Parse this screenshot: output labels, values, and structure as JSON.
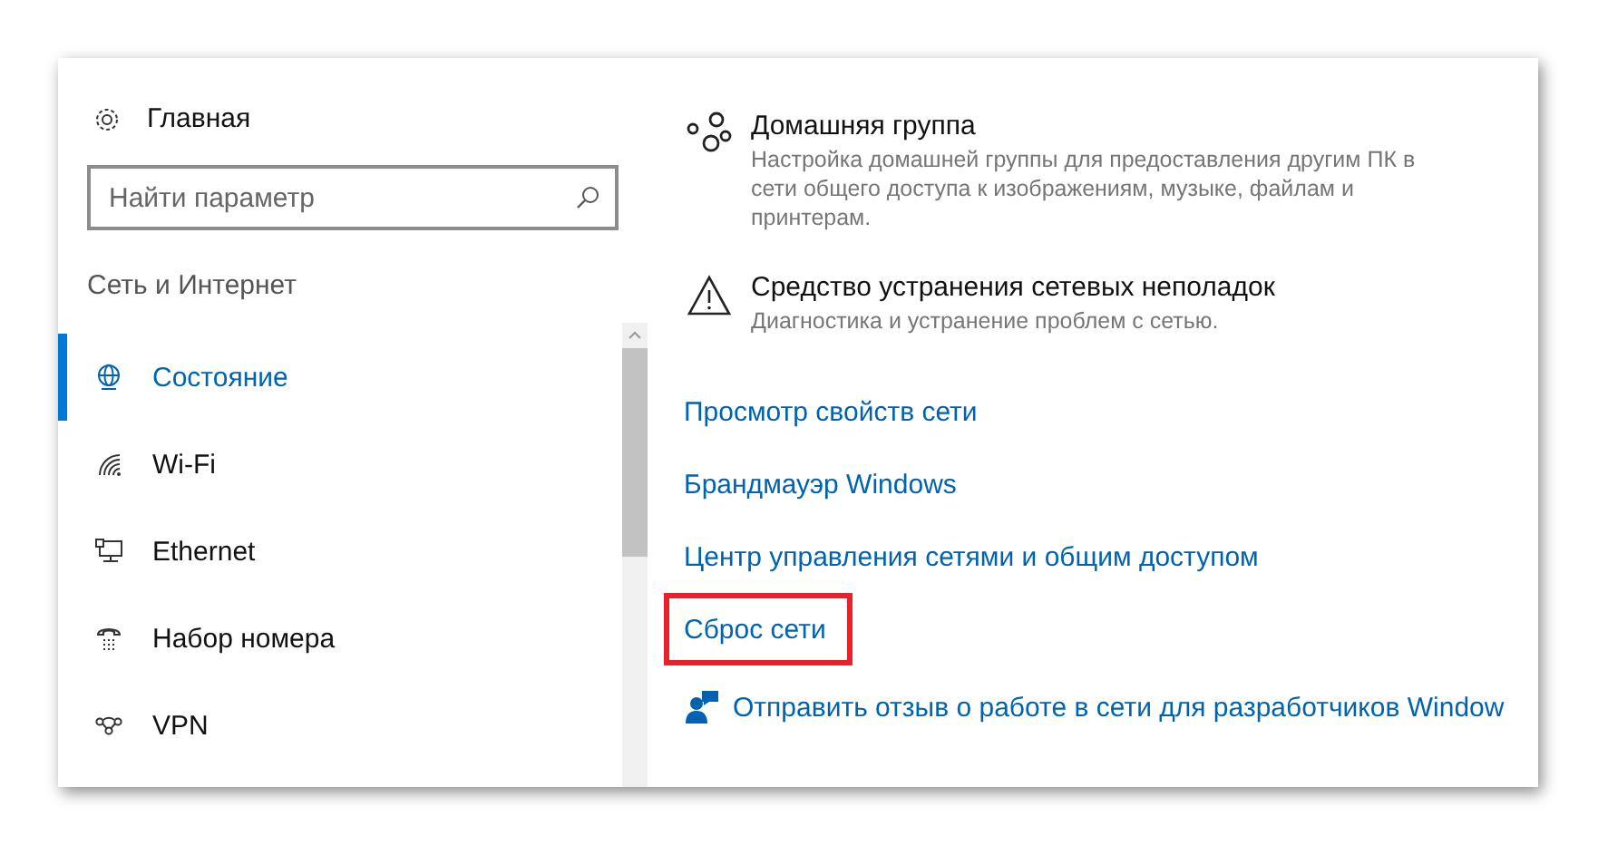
{
  "sidebar": {
    "home": "Главная",
    "search": {
      "placeholder": "Найти параметр"
    },
    "section": "Сеть и Интернет",
    "items": [
      {
        "kind": "status",
        "label": "Состояние",
        "selected": true
      },
      {
        "kind": "wifi",
        "label": "Wi-Fi",
        "selected": false
      },
      {
        "kind": "ethernet",
        "label": "Ethernet",
        "selected": false
      },
      {
        "kind": "dialup",
        "label": "Набор номера",
        "selected": false
      },
      {
        "kind": "vpn",
        "label": "VPN",
        "selected": false
      }
    ]
  },
  "content": {
    "entries": [
      {
        "kind": "homegroup",
        "title": "Домашняя группа",
        "description": "Настройка домашней группы для предоставления другим ПК в сети общего доступа к изображениям, музыке, файлам и принтерам."
      },
      {
        "kind": "troubleshoot",
        "title": "Средство устранения сетевых неполадок",
        "description": "Диагностика и устранение проблем с сетью."
      }
    ],
    "links": [
      {
        "label": "Просмотр свойств сети",
        "highlighted": false
      },
      {
        "label": "Брандмауэр Windows",
        "highlighted": false
      },
      {
        "label": "Центр управления сетями и общим доступом",
        "highlighted": false
      },
      {
        "label": "Сброс сети",
        "highlighted": true
      }
    ],
    "feedback": "Отправить отзыв о работе в сети для разработчиков Window"
  }
}
